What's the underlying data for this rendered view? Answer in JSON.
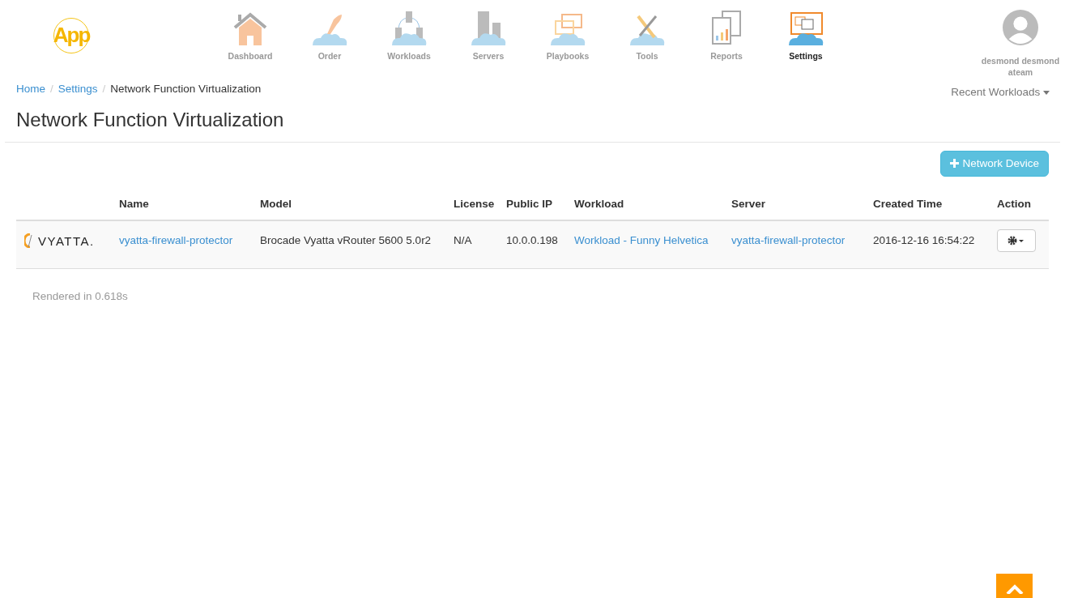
{
  "logo": {
    "text": "App"
  },
  "nav": [
    {
      "label": "Dashboard",
      "selected": false
    },
    {
      "label": "Order",
      "selected": false
    },
    {
      "label": "Workloads",
      "selected": false
    },
    {
      "label": "Servers",
      "selected": false
    },
    {
      "label": "Playbooks",
      "selected": false
    },
    {
      "label": "Tools",
      "selected": false
    },
    {
      "label": "Reports",
      "selected": false
    },
    {
      "label": "Settings",
      "selected": true
    }
  ],
  "user": {
    "name": "desmond desmond",
    "team": "ateam"
  },
  "breadcrumb": [
    "Home",
    "Settings",
    "Network Function Virtualization"
  ],
  "breadcrumb_separator": "/",
  "recent_menu": "Recent Workloads",
  "page_title": "Network Function Virtualization",
  "add_button": "Network Device",
  "table": {
    "columns": [
      "",
      "Name",
      "Model",
      "License",
      "Public IP",
      "Workload",
      "Server",
      "Created Time",
      "Action"
    ],
    "rows": [
      {
        "cells": [
          {
            "kind": "logo",
            "text": "VYATTA."
          },
          {
            "kind": "link",
            "text": "vyatta-firewall-protector"
          },
          {
            "kind": "text",
            "text": "Brocade Vyatta vRouter 5600 5.0r2"
          },
          {
            "kind": "text",
            "text": "N/A"
          },
          {
            "kind": "text",
            "text": "10.0.0.198"
          },
          {
            "kind": "link",
            "text": "Workload - Funny Helvetica"
          },
          {
            "kind": "link",
            "text": "vyatta-firewall-protector"
          },
          {
            "kind": "text",
            "text": "2016-12-16 16:54:22"
          },
          {
            "kind": "action"
          }
        ]
      }
    ]
  },
  "footer": "Rendered in 0.618s"
}
